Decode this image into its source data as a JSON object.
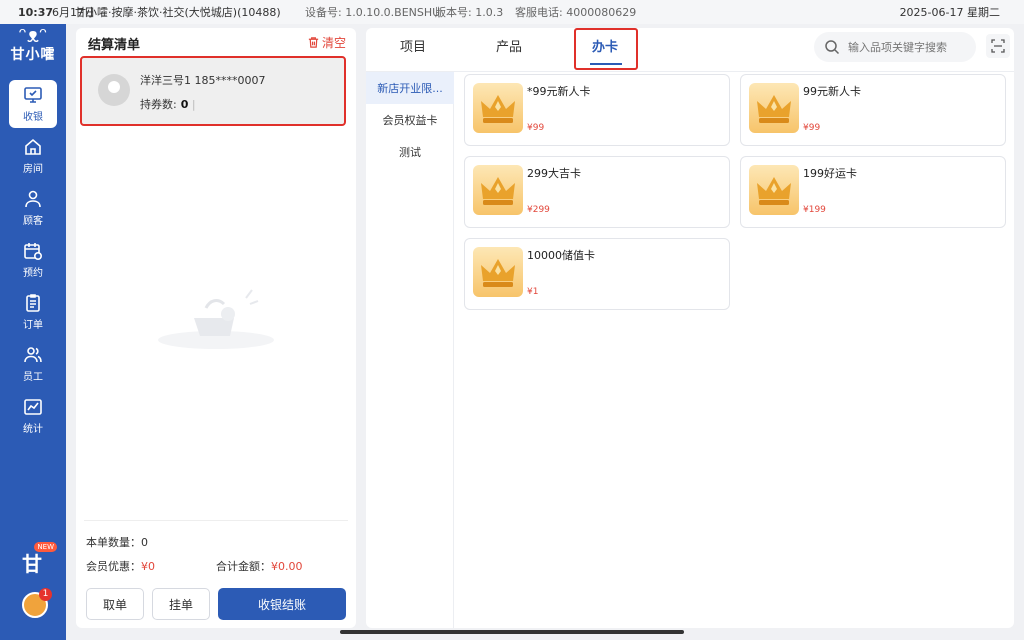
{
  "status_bar": {
    "time": "10:37",
    "date": "6月17日",
    "store": "甘小嚯·按摩·茶饮·社交(大悦城店)(10488)",
    "device": "设备号: 1.0.10.0.BENSHU",
    "version": "版本号: 1.0.3",
    "hotline": "客服电话: 4000080629",
    "right": "2025-06-17 星期二"
  },
  "logo": {
    "face": "ᵔᴥᵔ",
    "brand": "甘小嚯"
  },
  "nav": [
    {
      "label": "收银",
      "icon": "monitor-icon",
      "active": true
    },
    {
      "label": "房间",
      "icon": "home-icon",
      "active": false
    },
    {
      "label": "顾客",
      "icon": "user-icon",
      "active": false
    },
    {
      "label": "预约",
      "icon": "calendar-clock-icon",
      "active": false
    },
    {
      "label": "订单",
      "icon": "order-list-icon",
      "active": false
    },
    {
      "label": "员工",
      "icon": "staff-icon",
      "active": false
    },
    {
      "label": "统计",
      "icon": "chart-icon",
      "active": false
    }
  ],
  "rail_bottom": {
    "brand_char": "甘",
    "badge": "NEW",
    "avatar_badge": "1"
  },
  "settlement": {
    "title": "结算清单",
    "clear_label": "清空",
    "member": {
      "name": "洋洋三号1 185****0007",
      "coupons_label": "持券数:",
      "coupons_value": "0"
    },
    "order_count_label": "本单数量：",
    "order_count_value": "0",
    "discount_label": "会员优惠：",
    "discount_value": "¥0",
    "total_label": "合计金额：",
    "total_value": "¥0.00",
    "buttons": {
      "take": "取单",
      "hold": "挂单",
      "checkout": "收银结账"
    }
  },
  "tabs": [
    {
      "label": "项目",
      "active": false
    },
    {
      "label": "产品",
      "active": false
    },
    {
      "label": "办卡",
      "active": true
    }
  ],
  "search": {
    "placeholder": "输入品项关键字搜索"
  },
  "categories": [
    {
      "label": "新店开业限...",
      "active": true
    },
    {
      "label": "会员权益卡",
      "active": false
    },
    {
      "label": "测试",
      "active": false
    }
  ],
  "cards": [
    {
      "name": "*99元新人卡",
      "price": "¥99"
    },
    {
      "name": "99元新人卡",
      "price": "¥99"
    },
    {
      "name": "299大吉卡",
      "price": "¥299"
    },
    {
      "name": "199好运卡",
      "price": "¥199"
    },
    {
      "name": "10000储值卡",
      "price": "¥1"
    }
  ],
  "colors": {
    "primary": "#2c5bb5",
    "highlight": "#e0302a",
    "price": "#e2473b"
  }
}
